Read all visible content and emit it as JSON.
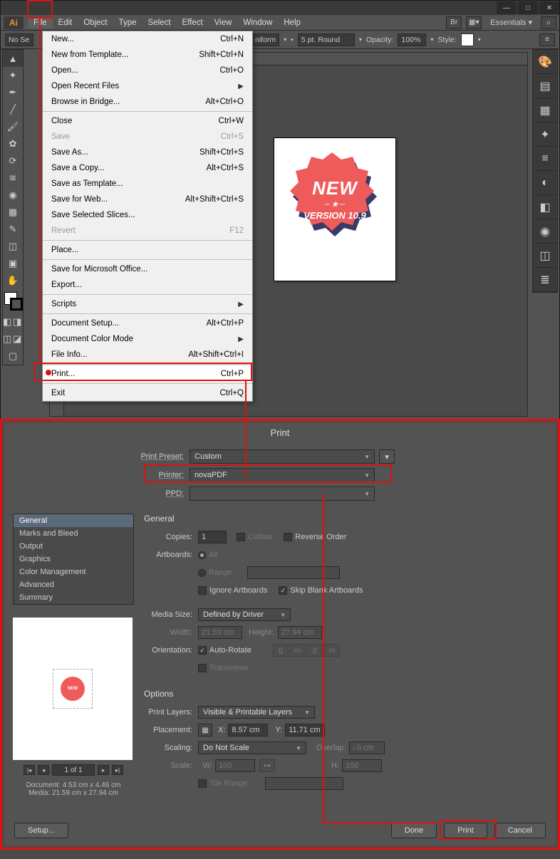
{
  "menubar": [
    "File",
    "Edit",
    "Object",
    "Type",
    "Select",
    "Effect",
    "View",
    "Window",
    "Help"
  ],
  "essentials": "Essentials",
  "optbar": {
    "no_selection": "No Se",
    "uniform": "niform",
    "stroke": "5 pt. Round",
    "opacity_label": "Opacity:",
    "opacity": "100%",
    "style_label": "Style:"
  },
  "file_menu": [
    {
      "t": "item",
      "label": "New...",
      "sc": "Ctrl+N"
    },
    {
      "t": "item",
      "label": "New from Template...",
      "sc": "Shift+Ctrl+N"
    },
    {
      "t": "item",
      "label": "Open...",
      "sc": "Ctrl+O"
    },
    {
      "t": "sub",
      "label": "Open Recent Files"
    },
    {
      "t": "item",
      "label": "Browse in Bridge...",
      "sc": "Alt+Ctrl+O"
    },
    {
      "t": "sep"
    },
    {
      "t": "item",
      "label": "Close",
      "sc": "Ctrl+W"
    },
    {
      "t": "dis",
      "label": "Save",
      "sc": "Ctrl+S"
    },
    {
      "t": "item",
      "label": "Save As...",
      "sc": "Shift+Ctrl+S"
    },
    {
      "t": "item",
      "label": "Save a Copy...",
      "sc": "Alt+Ctrl+S"
    },
    {
      "t": "item",
      "label": "Save as Template..."
    },
    {
      "t": "item",
      "label": "Save for Web...",
      "sc": "Alt+Shift+Ctrl+S"
    },
    {
      "t": "item",
      "label": "Save Selected Slices..."
    },
    {
      "t": "dis",
      "label": "Revert",
      "sc": "F12"
    },
    {
      "t": "sep"
    },
    {
      "t": "item",
      "label": "Place..."
    },
    {
      "t": "sep"
    },
    {
      "t": "item",
      "label": "Save for Microsoft Office..."
    },
    {
      "t": "item",
      "label": "Export..."
    },
    {
      "t": "sep"
    },
    {
      "t": "sub",
      "label": "Scripts"
    },
    {
      "t": "sep"
    },
    {
      "t": "item",
      "label": "Document Setup...",
      "sc": "Alt+Ctrl+P"
    },
    {
      "t": "sub",
      "label": "Document Color Mode"
    },
    {
      "t": "item",
      "label": "File Info...",
      "sc": "Alt+Shift+Ctrl+I"
    },
    {
      "t": "sep"
    },
    {
      "t": "hl",
      "label": "Print...",
      "sc": "Ctrl+P"
    },
    {
      "t": "sep"
    },
    {
      "t": "item",
      "label": "Exit",
      "sc": "Ctrl+Q"
    }
  ],
  "badge": {
    "line1": "NEW",
    "star": "★",
    "line2": "VERSION 10.9",
    "prev": "NEW"
  },
  "print": {
    "title": "Print",
    "preset_label": "Print Preset:",
    "preset_value": "Custom",
    "printer_label": "Printer:",
    "printer_value": "novaPDF",
    "ppd_label": "PPD:",
    "categories": [
      "General",
      "Marks and Bleed",
      "Output",
      "Graphics",
      "Color Management",
      "Advanced",
      "Summary"
    ],
    "general": {
      "title": "General",
      "copies_label": "Copies:",
      "copies": "1",
      "collate": "Collate",
      "reverse": "Reverse Order",
      "artboards_label": "Artboards:",
      "all": "All",
      "range_label": "Range",
      "range": "",
      "ignore": "Ignore Artboards",
      "skip": "Skip Blank Artboards",
      "media_label": "Media Size:",
      "media": "Defined by Driver",
      "width_label": "Width:",
      "width": "21.59 cm",
      "height_label": "Height:",
      "height": "27.94 cm",
      "orient_label": "Orientation:",
      "auto": "Auto-Rotate",
      "transverse": "Transverse"
    },
    "options": {
      "title": "Options",
      "layers_label": "Print Layers:",
      "layers": "Visible & Printable Layers",
      "placement_label": "Placement:",
      "x_label": "X:",
      "x": "8.57 cm",
      "y_label": "Y:",
      "y": "11.71 cm",
      "scaling_label": "Scaling:",
      "scaling": "Do Not Scale",
      "overlap_label": "Overlap:",
      "overlap": "0 cm",
      "scale_label": "Scale:",
      "w_label": "W:",
      "w": "100",
      "h_label": "H:",
      "h": "100",
      "tile_label": "Tile Range:",
      "tile": ""
    },
    "pager": "1 of 1",
    "docinfo1": "Document: 4.53 cm x 4.46 cm",
    "docinfo2": "Media: 21.59 cm x 27.94 cm",
    "setup": "Setup...",
    "done": "Done",
    "print_btn": "Print",
    "cancel": "Cancel"
  }
}
